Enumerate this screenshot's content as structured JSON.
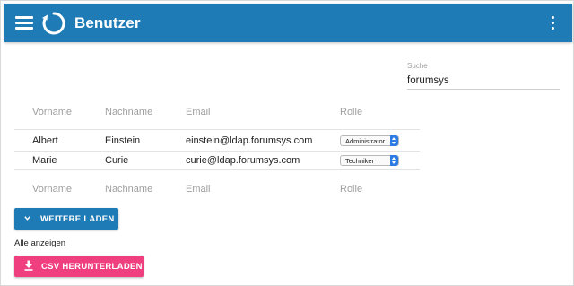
{
  "appbar": {
    "title": "Benutzer",
    "menu_icon": "hamburger-menu-icon",
    "logo_icon": "refresh-circle-logo-icon",
    "more_icon": "more-vertical-icon",
    "color": "#1f7bb6"
  },
  "search": {
    "label": "Suche",
    "value": "forumsys"
  },
  "table": {
    "columns": [
      "Vorname",
      "Nachname",
      "Email",
      "Rolle"
    ],
    "rows": [
      {
        "first": "Albert",
        "last": "Einstein",
        "email": "einstein@ldap.forumsys.com",
        "role": "Administrator"
      },
      {
        "first": "Marie",
        "last": "Curie",
        "email": "curie@ldap.forumsys.com",
        "role": "Techniker"
      }
    ],
    "footer_columns": [
      "Vorname",
      "Nachname",
      "Email",
      "Rolle"
    ]
  },
  "actions": {
    "load_more_label": "WEITERE LADEN",
    "load_more_icon": "chevron-down-icon",
    "show_all_label": "Alle anzeigen",
    "csv_label": "CSV HERUNTERLADEN",
    "csv_icon": "download-icon",
    "csv_color": "#ef3f7f"
  }
}
